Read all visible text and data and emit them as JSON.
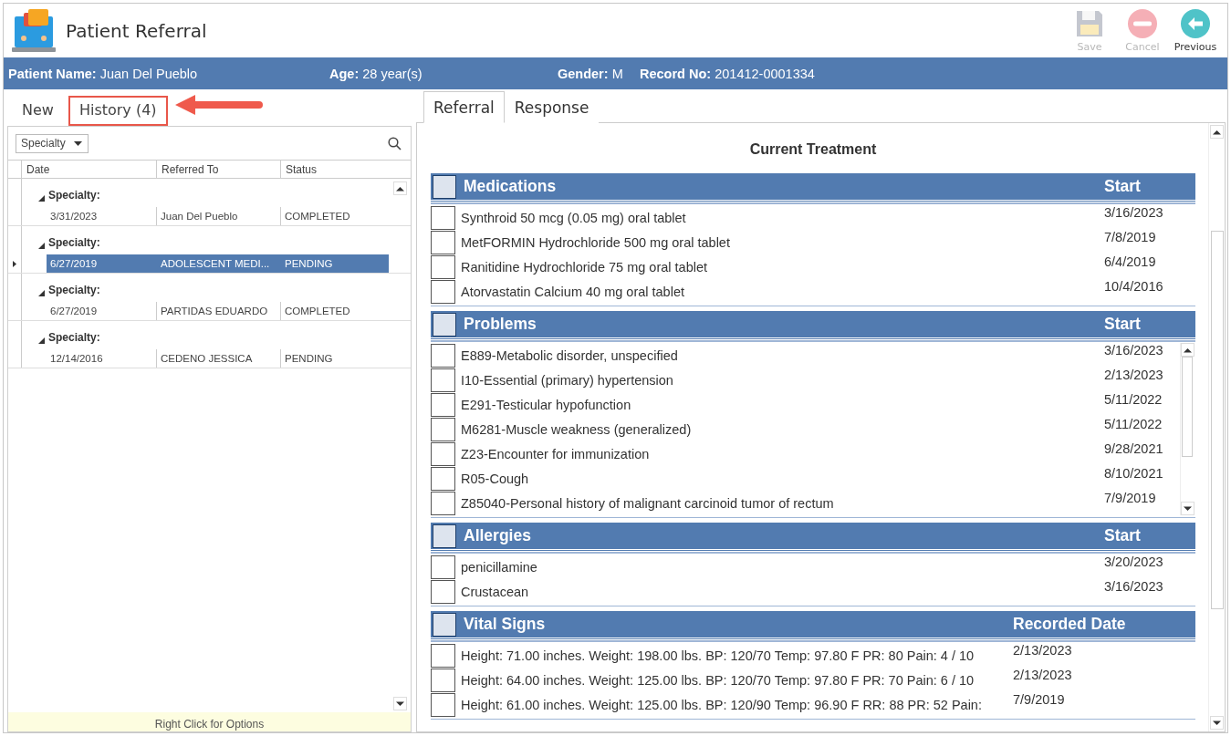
{
  "app": {
    "title": "Patient Referral"
  },
  "toolbar": [
    {
      "label": "Save",
      "kind": "save",
      "disabled": true
    },
    {
      "label": "Cancel",
      "kind": "cancel",
      "disabled": true
    },
    {
      "label": "Previous",
      "kind": "previous",
      "disabled": false
    }
  ],
  "patient_bar": [
    {
      "label": "Patient Name:",
      "value": "Juan Del Pueblo"
    },
    {
      "label": "Age:",
      "value": "28 year(s)"
    },
    {
      "label": "Gender:",
      "value": "M"
    },
    {
      "label": "Record No:",
      "value": "201412-0001334"
    }
  ],
  "left_tabs": [
    {
      "label": "New",
      "selected": false
    },
    {
      "label": "History",
      "count": "(4)",
      "selected": true
    }
  ],
  "filter": {
    "value": "Specialty"
  },
  "history_table": {
    "columns": [
      "Date",
      "Referred To",
      "Status"
    ],
    "groups": [
      {
        "label": "Specialty:",
        "expanded": true,
        "rows": [
          {
            "cells": [
              "3/31/2023",
              "Juan  Del Pueblo",
              "COMPLETED"
            ],
            "selected": false
          }
        ]
      },
      {
        "label": "Specialty:",
        "expanded": true,
        "rows": [
          {
            "cells": [
              "6/27/2019",
              "ADOLESCENT MEDI...",
              "PENDING"
            ],
            "selected": true
          }
        ]
      },
      {
        "label": "Specialty:",
        "expanded": true,
        "rows": [
          {
            "cells": [
              "6/27/2019",
              "PARTIDAS EDUARDO",
              "COMPLETED"
            ],
            "selected": false
          }
        ]
      },
      {
        "label": "Specialty:",
        "expanded": true,
        "rows": [
          {
            "cells": [
              "12/14/2016",
              "CEDENO JESSICA",
              "PENDING"
            ],
            "selected": false
          }
        ]
      }
    ]
  },
  "footer_hint": "Right Click for Options",
  "right_tabs": [
    {
      "label": "Referral",
      "selected": true
    },
    {
      "label": "Response",
      "selected": false
    }
  ],
  "section_title": "Current Treatment",
  "sections": [
    {
      "title": "Medications",
      "date_header": "Start",
      "kind": "plain",
      "checked": false,
      "items": [
        {
          "text": "Synthroid 50 mcg (0.05 mg) oral tablet",
          "date": "3/16/2023",
          "checked": false
        },
        {
          "text": "MetFORMIN Hydrochloride 500 mg oral tablet",
          "date": "7/8/2019",
          "checked": false
        },
        {
          "text": "Ranitidine Hydrochloride 75 mg oral tablet",
          "date": "6/4/2019",
          "checked": false
        },
        {
          "text": "Atorvastatin Calcium 40 mg oral tablet",
          "date": "10/4/2016",
          "checked": false
        }
      ]
    },
    {
      "title": "Problems",
      "date_header": "Start",
      "kind": "scrolling",
      "checked": false,
      "items": [
        {
          "text": "E889-Metabolic disorder, unspecified",
          "date": "3/16/2023",
          "checked": false
        },
        {
          "text": "I10-Essential (primary) hypertension",
          "date": "2/13/2023",
          "checked": false
        },
        {
          "text": "E291-Testicular hypofunction",
          "date": "5/11/2022",
          "checked": false
        },
        {
          "text": "M6281-Muscle weakness (generalized)",
          "date": "5/11/2022",
          "checked": false
        },
        {
          "text": "Z23-Encounter for immunization",
          "date": "9/28/2021",
          "checked": false
        },
        {
          "text": "R05-Cough",
          "date": "8/10/2021",
          "checked": false
        },
        {
          "text": "Z85040-Personal history of malignant carcinoid tumor of rectum",
          "date": "7/9/2019",
          "checked": false
        }
      ]
    },
    {
      "title": "Allergies",
      "date_header": "Start",
      "kind": "plain",
      "checked": false,
      "items": [
        {
          "text": "penicillamine",
          "date": "3/20/2023",
          "checked": false
        },
        {
          "text": "Crustacean",
          "date": "3/16/2023",
          "checked": false
        }
      ]
    },
    {
      "title": "Vital Signs",
      "date_header": "Recorded Date",
      "kind": "wide",
      "checked": false,
      "items": [
        {
          "text": "Height: 71.00 inches. Weight: 198.00 lbs. BP: 120/70 Temp: 97.80 F PR: 80 Pain: 4 / 10",
          "date": "2/13/2023",
          "checked": false
        },
        {
          "text": "Height: 64.00 inches. Weight: 125.00 lbs. BP: 120/70 Temp: 97.80 F PR: 70 Pain: 6 / 10",
          "date": "2/13/2023",
          "checked": false
        },
        {
          "text": "Height: 61.00 inches. Weight: 125.00 lbs. BP: 120/90 Temp: 96.90 F RR: 88 PR: 52 Pain:",
          "date": "7/9/2019",
          "checked": false
        }
      ]
    }
  ]
}
